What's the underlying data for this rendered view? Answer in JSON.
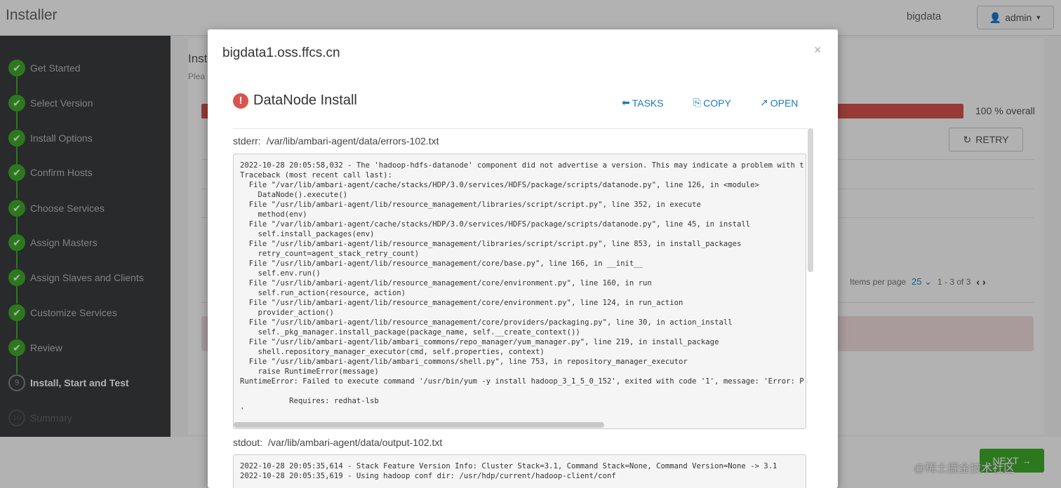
{
  "app": {
    "brand": "Installer",
    "cluster": "bigdata",
    "user": "admin"
  },
  "wizard": {
    "steps": [
      {
        "label": "Get Started",
        "state": "done"
      },
      {
        "label": "Select Version",
        "state": "done"
      },
      {
        "label": "Install Options",
        "state": "done"
      },
      {
        "label": "Confirm Hosts",
        "state": "done"
      },
      {
        "label": "Choose Services",
        "state": "done"
      },
      {
        "label": "Assign Masters",
        "state": "done"
      },
      {
        "label": "Assign Slaves and Clients",
        "state": "done"
      },
      {
        "label": "Customize Services",
        "state": "done"
      },
      {
        "label": "Review",
        "state": "done"
      },
      {
        "label": "Install, Start and Test",
        "state": "current",
        "number": "9"
      },
      {
        "label": "Summary",
        "state": "future",
        "number": "10"
      }
    ]
  },
  "main": {
    "title": "Inst",
    "subtitle": "Plea",
    "progress_label": "100 % overall",
    "progress_percent": 100,
    "retry_label": "RETRY",
    "items_per_page_label": "Items per page",
    "items_per_page_value": "25",
    "range_label": "1 - 3 of 3",
    "next_label": "NEXT →"
  },
  "watermark": "@稀土掘金技术社区",
  "modal": {
    "host": "bigdata1.oss.ffcs.cn",
    "close": "×",
    "task_title": "DataNode Install",
    "actions": {
      "tasks": "TASKS",
      "copy": "COPY",
      "open": "OPEN"
    },
    "stderr_label": "stderr:",
    "stderr_path": "/var/lib/ambari-agent/data/errors-102.txt",
    "stderr_text": "2022-10-28 20:05:58,032 - The 'hadoop-hdfs-datanode' component did not advertise a version. This may indicate a problem with t\nTraceback (most recent call last):\n  File \"/var/lib/ambari-agent/cache/stacks/HDP/3.0/services/HDFS/package/scripts/datanode.py\", line 126, in <module>\n    DataNode().execute()\n  File \"/usr/lib/ambari-agent/lib/resource_management/libraries/script/script.py\", line 352, in execute\n    method(env)\n  File \"/var/lib/ambari-agent/cache/stacks/HDP/3.0/services/HDFS/package/scripts/datanode.py\", line 45, in install\n    self.install_packages(env)\n  File \"/usr/lib/ambari-agent/lib/resource_management/libraries/script/script.py\", line 853, in install_packages\n    retry_count=agent_stack_retry_count)\n  File \"/usr/lib/ambari-agent/lib/resource_management/core/base.py\", line 166, in __init__\n    self.env.run()\n  File \"/usr/lib/ambari-agent/lib/resource_management/core/environment.py\", line 160, in run\n    self.run_action(resource, action)\n  File \"/usr/lib/ambari-agent/lib/resource_management/core/environment.py\", line 124, in run_action\n    provider_action()\n  File \"/usr/lib/ambari-agent/lib/resource_management/core/providers/packaging.py\", line 30, in action_install\n    self._pkg_manager.install_package(package_name, self.__create_context())\n  File \"/usr/lib/ambari-agent/lib/ambari_commons/repo_manager/yum_manager.py\", line 219, in install_package\n    shell.repository_manager_executor(cmd, self.properties, context)\n  File \"/usr/lib/ambari-agent/lib/ambari_commons/shell.py\", line 753, in repository_manager_executor\n    raise RuntimeError(message)\nRuntimeError: Failed to execute command '/usr/bin/yum -y install hadoop_3_1_5_0_152', exited with code '1', message: 'Error: P\n\n           Requires: redhat-lsb\n'",
    "stdout_label": "stdout:",
    "stdout_path": "/var/lib/ambari-agent/data/output-102.txt",
    "stdout_text": "2022-10-28 20:05:35,614 - Stack Feature Version Info: Cluster Stack=3.1, Command Stack=None, Command Version=None -> 3.1\n2022-10-28 20:05:35,619 - Using hadoop conf dir: /usr/hdp/current/hadoop-client/conf"
  }
}
